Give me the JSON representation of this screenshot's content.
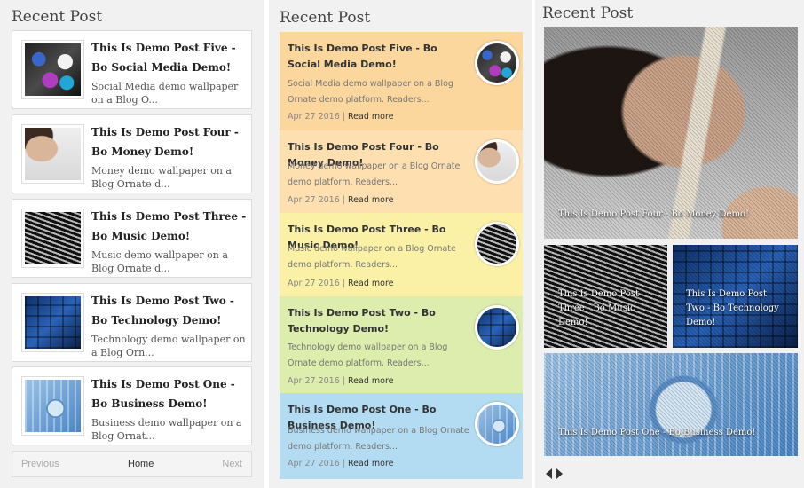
{
  "col1": {
    "title": "Recent Post",
    "posts": [
      {
        "title": "This Is Demo Post Five - Bo Social Media Demo!",
        "snippet": "Social Media demo wallpaper on a Blog O...",
        "icon": "social-media-thumbnail"
      },
      {
        "title": "This Is Demo Post Four - Bo Money Demo!",
        "snippet": "Money demo wallpaper on a Blog Ornate d...",
        "icon": "money-thumbnail"
      },
      {
        "title": "This Is Demo Post Three - Bo Music Demo!",
        "snippet": "Music demo wallpaper on a Blog Ornate d...",
        "icon": "music-thumbnail"
      },
      {
        "title": "This Is Demo Post Two - Bo Technology Demo!",
        "snippet": "Technology demo wallpaper on a Blog Orn...",
        "icon": "technology-thumbnail"
      },
      {
        "title": "This Is Demo Post One - Bo Business Demo!",
        "snippet": "Business demo wallpaper on a Blog Ornat...",
        "icon": "business-thumbnail"
      }
    ],
    "pager": {
      "prev": "Previous",
      "home": "Home",
      "next": "Next"
    }
  },
  "col2": {
    "title": "Recent Post",
    "posts": [
      {
        "title": "This Is Demo Post Five - Bo Social Media Demo!",
        "snippet": "Social Media demo wallpaper on a Blog Ornate demo platform. Readers...",
        "date": "Apr 27 2016",
        "sep": " | ",
        "read_more": "Read more",
        "color": "#fbd69d"
      },
      {
        "title": "This Is Demo Post Four - Bo Money Demo!",
        "snippet": "Money demo wallpaper on a Blog Ornate demo platform. Readers...",
        "date": "Apr 27 2016",
        "sep": " | ",
        "read_more": "Read more",
        "color": "#fddfb0"
      },
      {
        "title": "This Is Demo Post Three - Bo Music Demo!",
        "snippet": "Music demo wallpaper on a Blog Ornate demo platform. Readers...",
        "date": "Apr 27 2016",
        "sep": " | ",
        "read_more": "Read more",
        "color": "#fbf1a6"
      },
      {
        "title": "This Is Demo Post Two - Bo Technology Demo!",
        "snippet": "Technology demo wallpaper on a Blog Ornate demo platform. Readers...",
        "date": "Apr 27 2016",
        "sep": " | ",
        "read_more": "Read more",
        "color": "#dcedad"
      },
      {
        "title": "This Is Demo Post One - Bo Business Demo!",
        "snippet": "Business demo wallpaper on a Blog Ornate demo platform. Readers...",
        "date": "Apr 27 2016",
        "sep": " | ",
        "read_more": "Read more",
        "color": "#b3dcf3"
      }
    ]
  },
  "col3": {
    "title": "Recent Post",
    "featured": "This Is Demo Post Four - Bo Money Demo!",
    "tile_a": "This Is Demo Post Three - Bo Music Demo!",
    "tile_b": "This Is Demo Post Two - Bo Technology Demo!",
    "tile_c": "This Is Demo Post One - Bo Business Demo!"
  }
}
